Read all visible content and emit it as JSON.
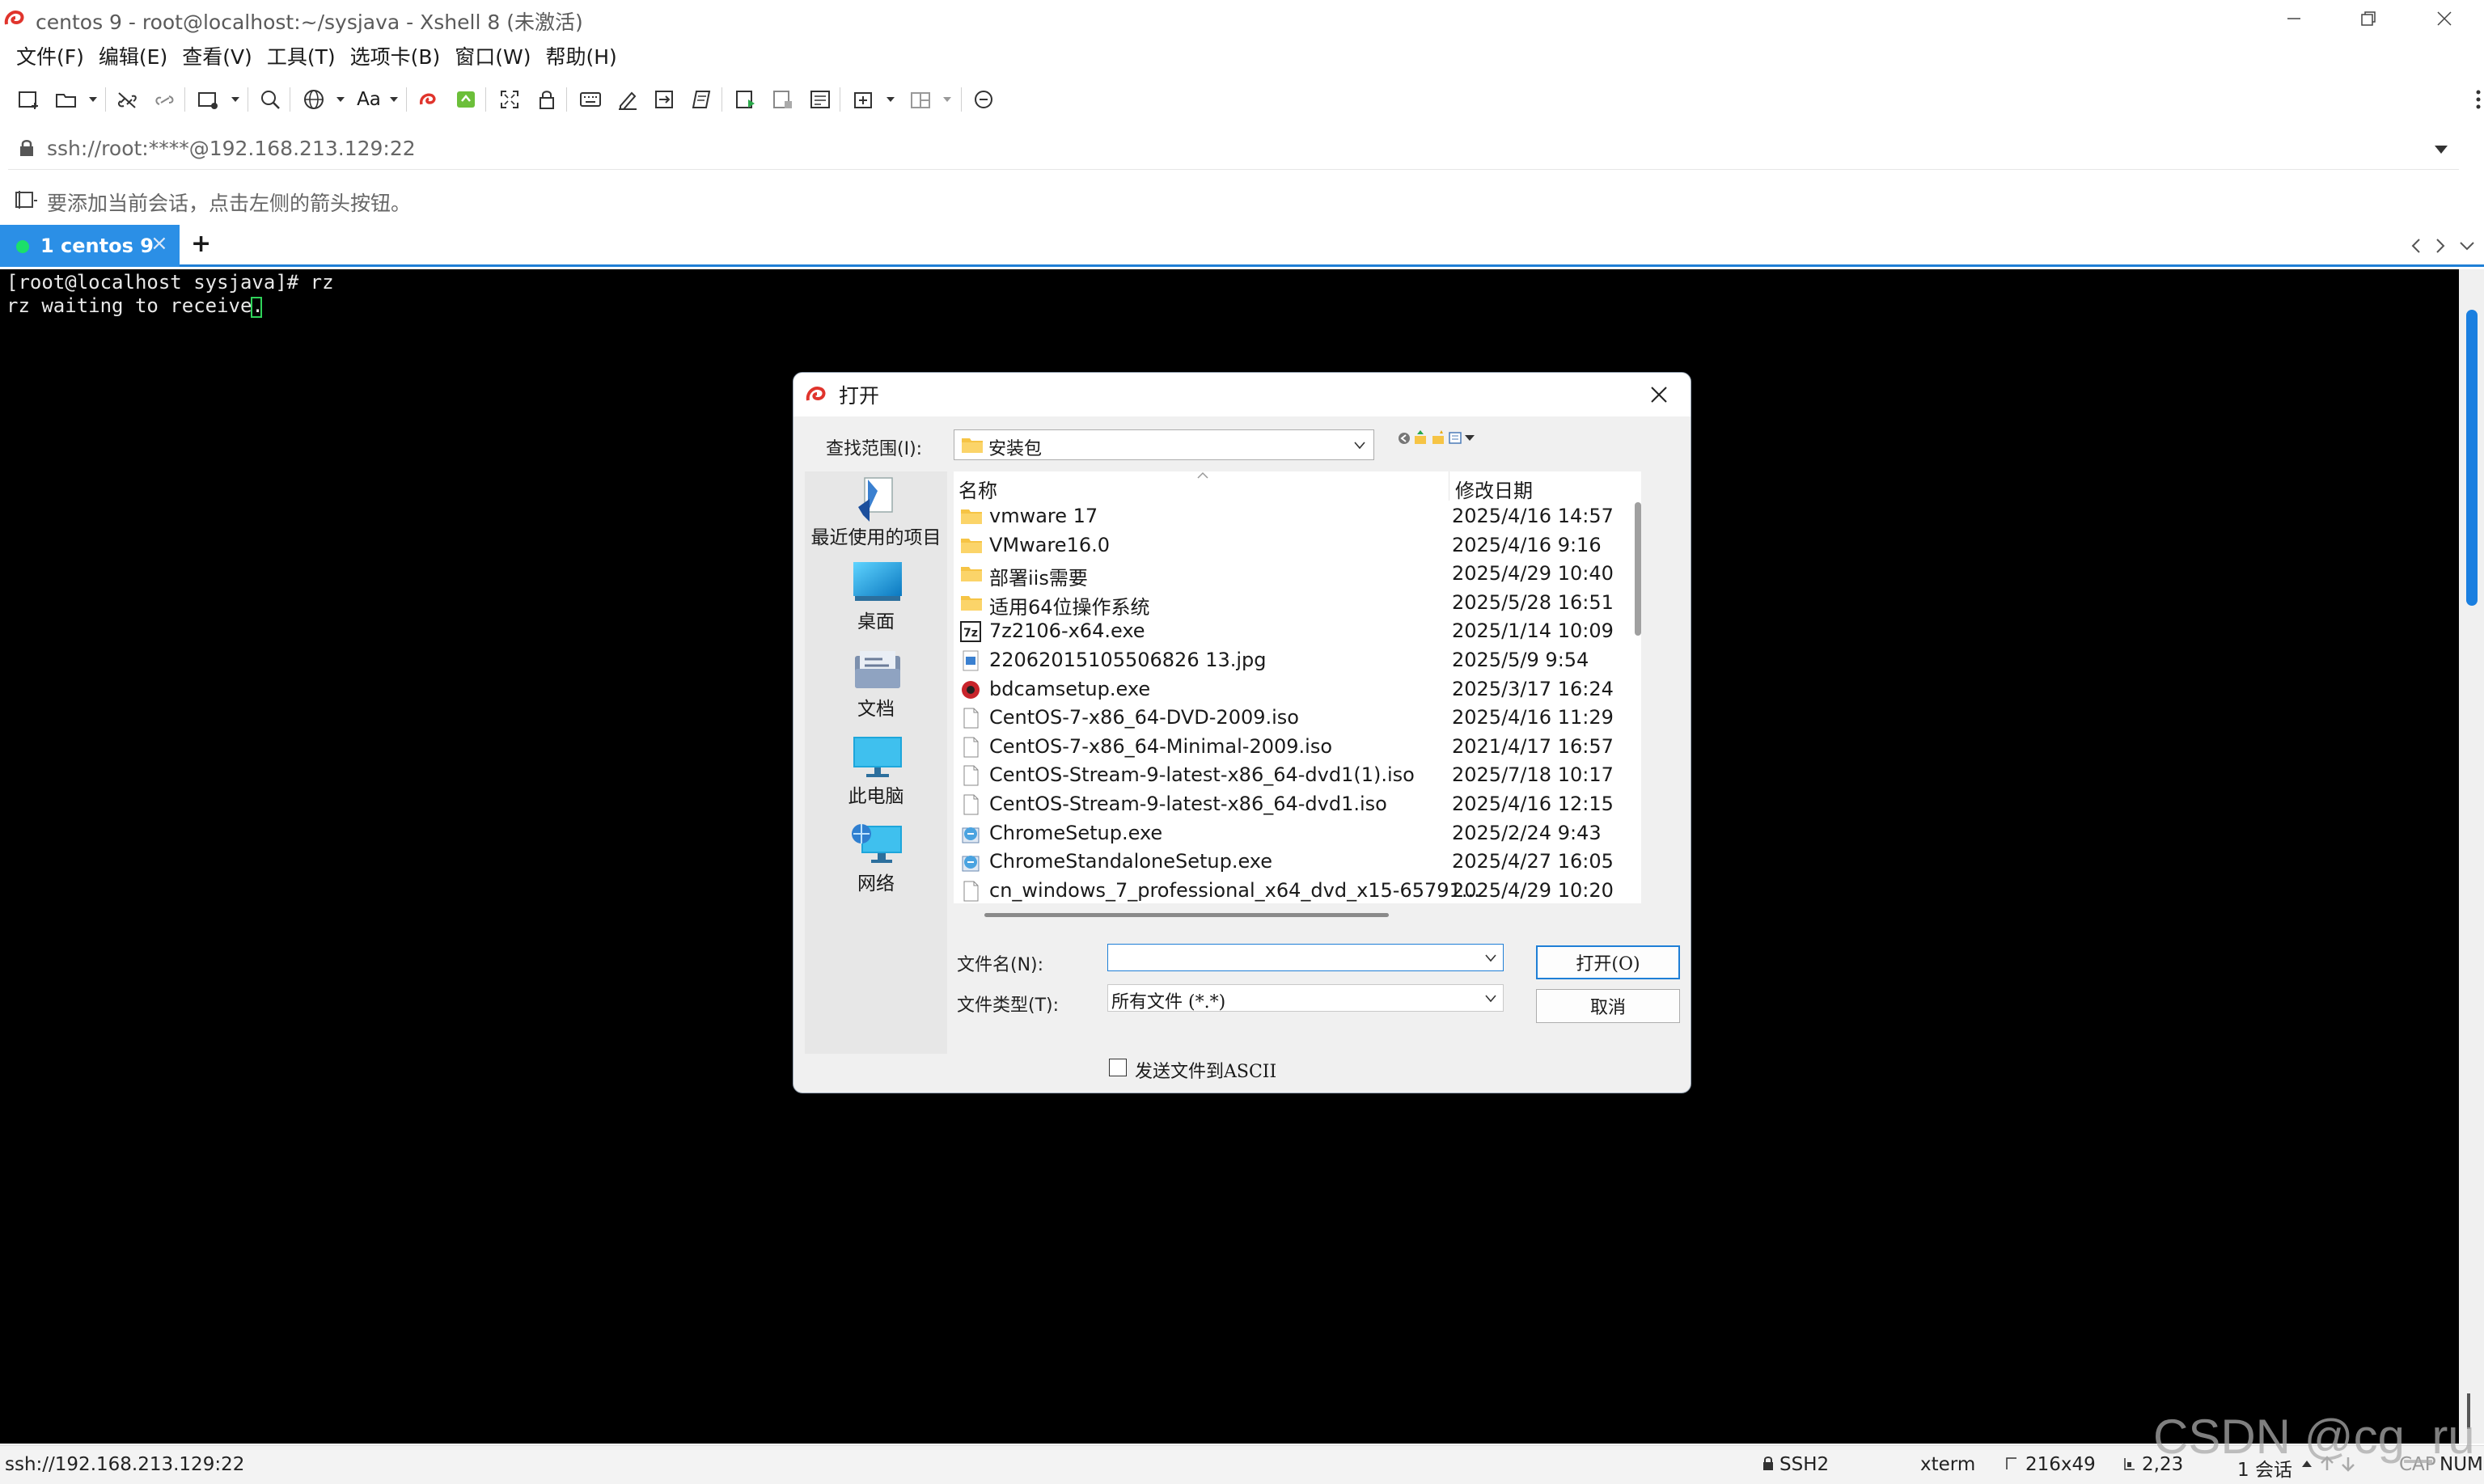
{
  "window": {
    "title": "centos 9 - root@localhost:~/sysjava - Xshell 8 (未激活)"
  },
  "menu": [
    "文件(F)",
    "编辑(E)",
    "查看(V)",
    "工具(T)",
    "选项卡(B)",
    "窗口(W)",
    "帮助(H)"
  ],
  "toolbar": {
    "font_label": "Aa"
  },
  "address": {
    "value": "ssh://root:****@192.168.213.129:22"
  },
  "hint": {
    "text": "要添加当前会话，点击左侧的箭头按钮。"
  },
  "tabs": [
    {
      "label": "1 centos 9",
      "close": "×"
    }
  ],
  "new_tab": "+",
  "terminal": {
    "lines": [
      "[root@localhost sysjava]# rz",
      "rz waiting to receive."
    ]
  },
  "dialog": {
    "title": "打开",
    "look_in_label": "查找范围(I):",
    "look_in_value": "安装包",
    "places": [
      {
        "label": "最近使用的项目",
        "icon": "recent-icon"
      },
      {
        "label": "桌面",
        "icon": "desktop-icon"
      },
      {
        "label": "文档",
        "icon": "documents-icon"
      },
      {
        "label": "此电脑",
        "icon": "computer-icon"
      },
      {
        "label": "网络",
        "icon": "network-icon"
      }
    ],
    "columns": {
      "name": "名称",
      "date": "修改日期"
    },
    "files": [
      {
        "name": "vmware 17",
        "date": "2025/4/16 14:57",
        "icon": "folder-icon"
      },
      {
        "name": "VMware16.0",
        "date": "2025/4/16 9:16",
        "icon": "folder-icon"
      },
      {
        "name": "部署iis需要",
        "date": "2025/4/29 10:40",
        "icon": "folder-icon"
      },
      {
        "name": "适用64位操作系统",
        "date": "2025/5/28 16:51",
        "icon": "folder-icon"
      },
      {
        "name": "7z2106-x64.exe",
        "date": "2025/1/14 10:09",
        "icon": "7zip-icon"
      },
      {
        "name": "22062015105506826 13.jpg",
        "date": "2025/5/9 9:54",
        "icon": "image-icon"
      },
      {
        "name": "bdcamsetup.exe",
        "date": "2025/3/17 16:24",
        "icon": "bdcam-icon"
      },
      {
        "name": "CentOS-7-x86_64-DVD-2009.iso",
        "date": "2025/4/16 11:29",
        "icon": "file-icon"
      },
      {
        "name": "CentOS-7-x86_64-Minimal-2009.iso",
        "date": "2021/4/17 16:57",
        "icon": "file-icon"
      },
      {
        "name": "CentOS-Stream-9-latest-x86_64-dvd1(1).iso",
        "date": "2025/7/18 10:17",
        "icon": "file-icon"
      },
      {
        "name": "CentOS-Stream-9-latest-x86_64-dvd1.iso",
        "date": "2025/4/16 12:15",
        "icon": "file-icon"
      },
      {
        "name": "ChromeSetup.exe",
        "date": "2025/2/24 9:43",
        "icon": "installer-icon"
      },
      {
        "name": "ChromeStandaloneSetup.exe",
        "date": "2025/4/27 16:05",
        "icon": "installer-icon"
      },
      {
        "name": "cn_windows_7_professional_x64_dvd_x15-65791...",
        "date": "2025/4/29 10:20",
        "icon": "file-icon"
      }
    ],
    "filename_label": "文件名(N):",
    "filename_value": "",
    "filetype_label": "文件类型(T):",
    "filetype_value": "所有文件 (*.*)",
    "open_label": "打开(O)",
    "cancel_label": "取消",
    "ascii_label": "发送文件到ASCII"
  },
  "status": {
    "address": "ssh://192.168.213.129:22",
    "protocol": "SSH2",
    "term": "xterm",
    "size": "216x49",
    "cursor": "2,23",
    "sessions": "1 会话",
    "cap": "CAP",
    "num": "NUM"
  },
  "watermark": "CSDN @cg_ru"
}
